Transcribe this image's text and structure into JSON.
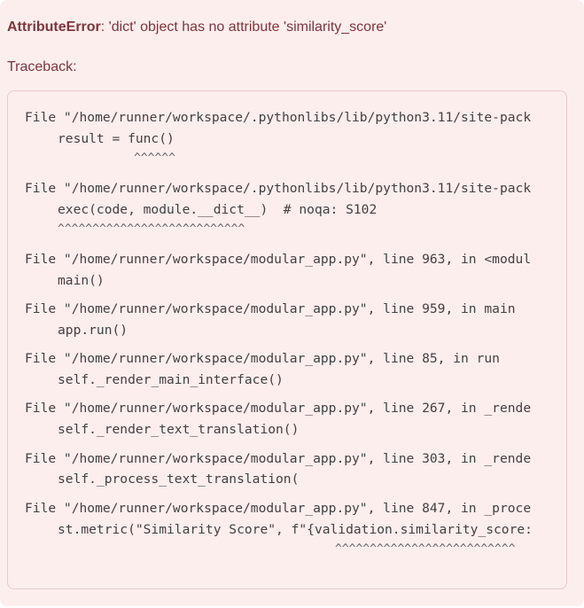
{
  "error": {
    "type": "AttributeError",
    "message": ": 'dict' object has no attribute 'similarity_score'"
  },
  "traceback": {
    "label": "Traceback:",
    "frames": [
      {
        "file_line": "File \"/home/runner/workspace/.pythonlibs/lib/python3.11/site-pack",
        "code": "result = func()",
        "carets": "^^^^^^"
      },
      {
        "file_line": "File \"/home/runner/workspace/.pythonlibs/lib/python3.11/site-pack",
        "code": "exec(code, module.__dict__)  # noqa: S102",
        "carets": "^^^^^^^^^^^^^^^^^^^^^^^^^^^"
      },
      {
        "file_line": "File \"/home/runner/workspace/modular_app.py\", line 963, in <modul",
        "code": "main()"
      },
      {
        "file_line": "File \"/home/runner/workspace/modular_app.py\", line 959, in main",
        "code": "app.run()"
      },
      {
        "file_line": "File \"/home/runner/workspace/modular_app.py\", line 85, in run",
        "code": "self._render_main_interface()"
      },
      {
        "file_line": "File \"/home/runner/workspace/modular_app.py\", line 267, in _rende",
        "code": "self._render_text_translation()"
      },
      {
        "file_line": "File \"/home/runner/workspace/modular_app.py\", line 303, in _rende",
        "code": "self._process_text_translation("
      },
      {
        "file_line": "File \"/home/runner/workspace/modular_app.py\", line 847, in _proce",
        "code": "st.metric(\"Similarity Score\", f\"{validation.similarity_score:",
        "carets": "^^^^^^^^^^^^^^^^^^^^^^^^^^"
      }
    ]
  }
}
